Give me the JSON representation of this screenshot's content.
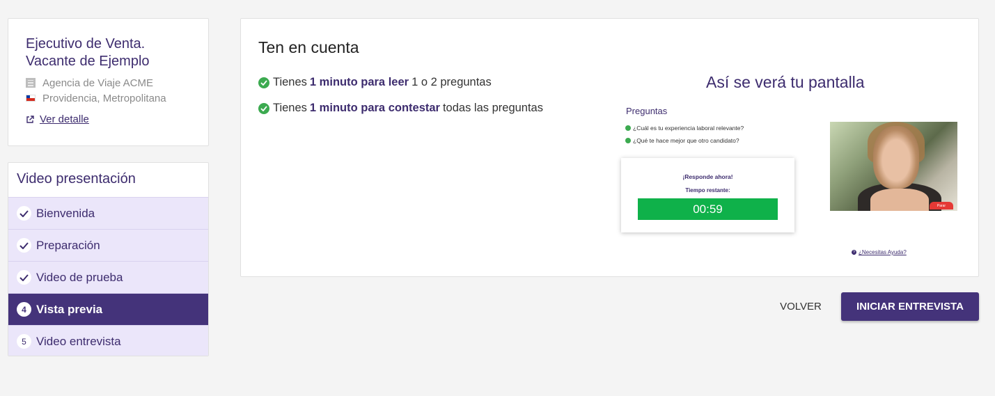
{
  "job": {
    "title": "Ejecutivo de Venta. Vacante de Ejemplo",
    "company": "Agencia de Viaje ACME",
    "location": "Providencia, Metropolitana",
    "detail_link": "Ver detalle",
    "company_icon": "building-icon",
    "location_icon": "chile-flag-icon"
  },
  "steps": {
    "title": "Video presentación",
    "items": [
      {
        "label": "Bienvenida",
        "state": "done",
        "badge": ""
      },
      {
        "label": "Preparación",
        "state": "done",
        "badge": ""
      },
      {
        "label": "Video de prueba",
        "state": "done",
        "badge": ""
      },
      {
        "label": "Vista previa",
        "state": "active",
        "badge": "4"
      },
      {
        "label": "Video entrevista",
        "state": "pending",
        "badge": "5"
      }
    ]
  },
  "main": {
    "title": "Ten en cuenta",
    "tips": [
      {
        "pre": "Tienes",
        "bold": "1 minuto para leer",
        "post": "1 o 2 preguntas"
      },
      {
        "pre": "Tienes",
        "bold": "1 minuto para contestar",
        "post": "todas las preguntas"
      }
    ],
    "preview": {
      "title": "Así se verá tu pantalla",
      "questions_title": "Preguntas",
      "questions": [
        "¿Cuál es tu experiencia laboral relevante?",
        "¿Qué te hace mejor que otro candidato?"
      ],
      "respond_now": "¡Responde ahora!",
      "time_remaining": "Tiempo restante:",
      "timer": "00:59",
      "stop_label": "Parar",
      "help": "¿Necesitas Ayuda?"
    }
  },
  "footer": {
    "back_label": "VOLVER",
    "start_label": "INICIAR ENTREVISTA"
  },
  "colors": {
    "brand": "#44337a",
    "step_bg": "#ebe6fa",
    "success": "#3caa50",
    "timer": "#0fb14a"
  }
}
